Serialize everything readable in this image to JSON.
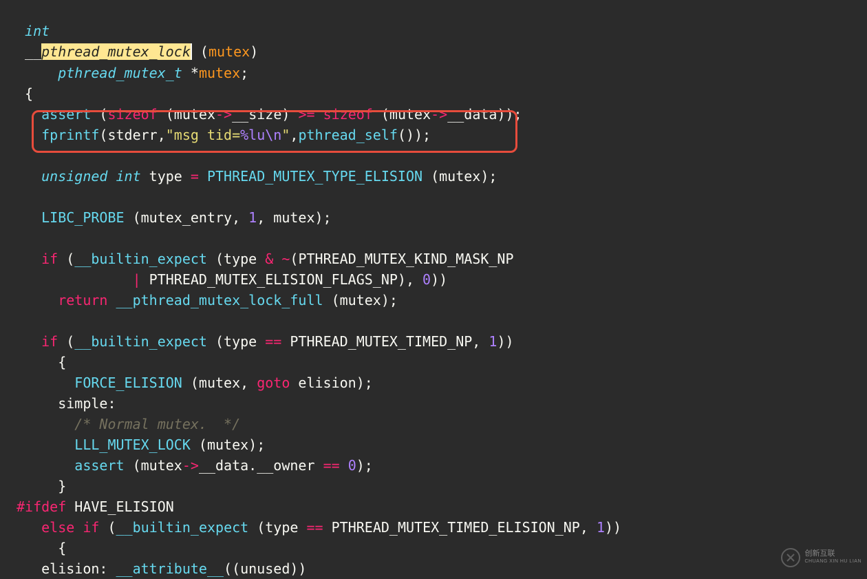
{
  "code": {
    "l1": {
      "kw": "int"
    },
    "l2": {
      "u1": "__",
      "hl": "pthread_mutex_lock",
      "paren": " (",
      "arg": "mutex",
      "close": ")"
    },
    "l3": {
      "type": "pthread_mutex_t",
      "star": " *",
      "arg": "mutex",
      ";": ";"
    },
    "l4": {
      "brace": "{"
    },
    "l5": {
      "fn": "assert",
      "op1": " (",
      "sz1": "sizeof",
      "op2": " (mutex",
      "arrow": "->",
      "m1": "__size) ",
      "ge": ">=",
      "sp": " ",
      "sz2": "sizeof",
      "op3": " (mutex",
      "arrow2": "->",
      "m2": "__data));"
    },
    "l6": {
      "fn": "fprintf",
      "op": "(stderr,",
      "str1": "\"msg tid=",
      "esc": "%lu\\n",
      "str2": "\"",
      "comma": ",",
      "call": "pthread_self",
      "tail": "());"
    },
    "l7": {},
    "l8": {
      "kw": "unsigned",
      "sp": " ",
      "kw2": "int",
      "var": " type ",
      "eq": "=",
      "call": " PTHREAD_MUTEX_TYPE_ELISION ",
      "args": "(mutex);"
    },
    "l9": {},
    "l10": {
      "fn": "LIBC_PROBE",
      "args": " (mutex_entry, ",
      "num": "1",
      "tail": ", mutex);"
    },
    "l11": {},
    "l12": {
      "kw": "if",
      "a": " (",
      "fn": "__builtin_expect",
      "b": " (type ",
      "op": "&",
      "c": " ",
      "neg": "~",
      "d": "(PTHREAD_MUTEX_KIND_MASK_NP"
    },
    "l13": {
      "pipe": "|",
      "rest": " PTHREAD_MUTEX_ELISION_FLAGS_NP), ",
      "num": "0",
      "tail": "))"
    },
    "l14": {
      "kw": "return",
      "sp": " ",
      "fn": "__pthread_mutex_lock_full",
      "args": " (mutex);"
    },
    "l15": {},
    "l16": {
      "kw": "if",
      "a": " (",
      "fn": "__builtin_expect",
      "b": " (type ",
      "eq": "==",
      "c": " PTHREAD_MUTEX_TIMED_NP, ",
      "num": "1",
      "tail": "))"
    },
    "l17": {
      "brace": "{"
    },
    "l18": {
      "fn": "FORCE_ELISION",
      "a": " (mutex, ",
      "kw": "goto",
      "b": " elision);"
    },
    "l19": {
      "label": "simple:"
    },
    "l20": {
      "cmt": "/* Normal mutex.  */"
    },
    "l21": {
      "fn": "LLL_MUTEX_LOCK",
      "args": " (mutex);"
    },
    "l22": {
      "fn": "assert",
      "a": " (mutex",
      "arrow": "->",
      "m": "__data.__owner ",
      "eq": "==",
      "sp": " ",
      "num": "0",
      "tail": ");"
    },
    "l23": {
      "brace": "}"
    },
    "l24": {
      "pp": "#ifdef",
      "sp": " ",
      "id": "HAVE_ELISION"
    },
    "l25": {
      "kw": "else",
      "sp": " ",
      "kw2": "if",
      "a": " (",
      "fn": "__builtin_expect",
      "b": " (type ",
      "eq": "==",
      "c": " PTHREAD_MUTEX_TIMED_ELISION_NP, ",
      "num": "1",
      "tail": "))"
    },
    "l26": {
      "brace": "{"
    },
    "l27": {
      "label": "elision:",
      "sp": " ",
      "attr": "__attribute__",
      "args": "((unused))"
    }
  },
  "watermark": {
    "cn": "创新互联",
    "py": "CHUANG XIN HU LIAN"
  }
}
